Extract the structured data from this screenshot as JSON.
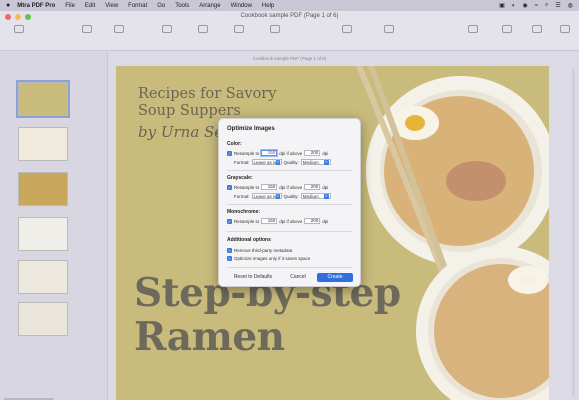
{
  "menubar": {
    "apple": "",
    "app_name": "Mtra PDF Pro",
    "items": [
      "File",
      "Edit",
      "View",
      "Format",
      "Go",
      "Tools",
      "Arrange",
      "Window",
      "Help"
    ]
  },
  "window": {
    "title": "Cookbook sample PDF (Page 1 of 6)",
    "tab_title": "Cookbook sample PDF (Page 1 of 6)"
  },
  "document": {
    "title_line1": "Recipes for Savory",
    "title_line2": "Soup Suppers",
    "author": "by Urna Sen",
    "big_line1": "Step-by-step",
    "big_line2": "Ramen"
  },
  "dialog": {
    "title": "Optimize Images",
    "color": {
      "heading": "Color:",
      "resample_label": "Resample to",
      "resample_value": "150",
      "dpi_if_above_label": "dpi if above",
      "dpi_if_above_value": "200",
      "dpi_unit": "dpi",
      "format_label": "Format:",
      "format_value": "Leave as is",
      "quality_label": "Quality:",
      "quality_value": "Medium"
    },
    "grayscale": {
      "heading": "Grayscale:",
      "resample_label": "Resample to",
      "resample_value": "150",
      "dpi_if_above_label": "dpi if above",
      "dpi_if_above_value": "200",
      "dpi_unit": "dpi",
      "format_label": "Format:",
      "format_value": "Leave as is",
      "quality_label": "Quality:",
      "quality_value": "Medium"
    },
    "monochrome": {
      "heading": "Monochrome:",
      "resample_label": "Resample to",
      "resample_value": "150",
      "dpi_if_above_label": "dpi if above",
      "dpi_if_above_value": "200",
      "dpi_unit": "dpi"
    },
    "additional": {
      "heading": "Additional options",
      "opt1": "Remove third-party metadata",
      "opt2": "Optimize images only if it saves space"
    },
    "buttons": {
      "reset": "Reset to Defaults",
      "cancel": "Cancel",
      "create": "Create"
    }
  },
  "colors": {
    "accent": "#2f6fdf",
    "page_bg": "#c9bb7c",
    "checkbox": "#3b7ae0"
  }
}
